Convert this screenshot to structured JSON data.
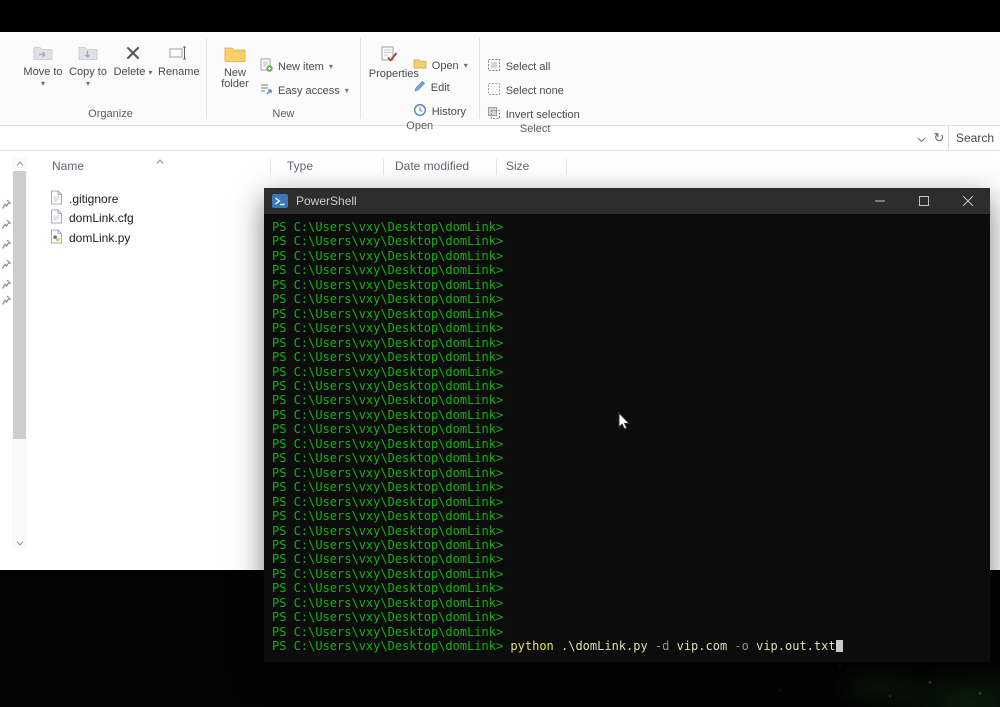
{
  "explorer": {
    "ribbon": {
      "groups": [
        {
          "label": "Organize"
        },
        {
          "label": "New"
        },
        {
          "label": "Open"
        },
        {
          "label": "Select"
        }
      ],
      "buttons": {
        "move_to": "Move to",
        "copy_to": "Copy to",
        "delete": "Delete",
        "rename": "Rename",
        "new_folder": "New folder",
        "new_item": "New item",
        "easy_access": "Easy access",
        "properties": "Properties",
        "open": "Open",
        "edit": "Edit",
        "history": "History",
        "select_all": "Select all",
        "select_none": "Select none",
        "invert_selection": "Invert selection"
      }
    },
    "address_bar": {
      "search_label": "Search"
    },
    "list": {
      "columns": [
        "Name",
        "Type",
        "Date modified",
        "Size"
      ],
      "files": [
        {
          "name": ".gitignore",
          "icon": "text-file-icon"
        },
        {
          "name": "domLink.cfg",
          "icon": "config-file-icon"
        },
        {
          "name": "domLink.py",
          "icon": "python-file-icon"
        }
      ]
    }
  },
  "powershell": {
    "title": "PowerShell",
    "prompt": "PS C:\\Users\\vxy\\Desktop\\domLink>",
    "prompt_lines": 29,
    "command_parts": [
      {
        "text": "python ",
        "cls": "cmd"
      },
      {
        "text": ".\\domLink.py ",
        "cls": "arg"
      },
      {
        "text": "-d ",
        "cls": "param"
      },
      {
        "text": "vip.com ",
        "cls": "arg"
      },
      {
        "text": "-o ",
        "cls": "param"
      },
      {
        "text": "vip.out.txt",
        "cls": "arg"
      }
    ],
    "colors": {
      "bg": "#0c0c0c",
      "prompt": "#13b30e",
      "cmd": "#e3e35a",
      "param": "#8f8f8f",
      "arg": "#dedeb2",
      "titlebar": "#2d2d2d"
    }
  }
}
